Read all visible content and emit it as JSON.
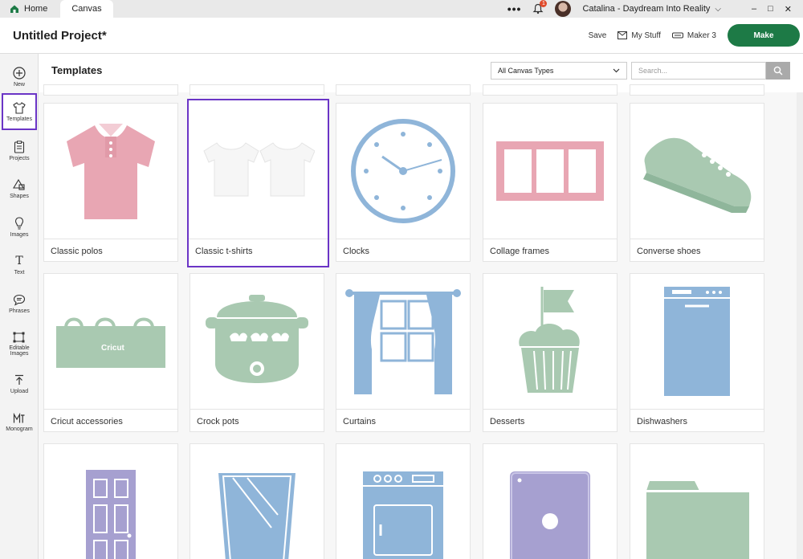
{
  "titlebar": {
    "home_tab": "Home",
    "canvas_tab": "Canvas",
    "notification_count": "1",
    "user_name": "Catalina - Daydream Into Reality"
  },
  "header": {
    "project_title": "Untitled Project*",
    "save_label": "Save",
    "my_stuff_label": "My Stuff",
    "machine_label": "Maker 3",
    "make_label": "Make"
  },
  "sidebar": {
    "items": [
      {
        "label": "New"
      },
      {
        "label": "Templates"
      },
      {
        "label": "Projects"
      },
      {
        "label": "Shapes"
      },
      {
        "label": "Images"
      },
      {
        "label": "Text"
      },
      {
        "label": "Phrases"
      },
      {
        "label": "Editable Images"
      },
      {
        "label": "Upload"
      },
      {
        "label": "Monogram"
      }
    ]
  },
  "templates": {
    "title": "Templates",
    "canvas_type": "All Canvas Types",
    "search_placeholder": "Search...",
    "cards": [
      {
        "label": "Classic polos"
      },
      {
        "label": "Classic t-shirts"
      },
      {
        "label": "Clocks"
      },
      {
        "label": "Collage frames"
      },
      {
        "label": "Converse shoes"
      },
      {
        "label": "Cricut accessories"
      },
      {
        "label": "Crock pots"
      },
      {
        "label": "Curtains"
      },
      {
        "label": "Desserts"
      },
      {
        "label": "Dishwashers"
      }
    ],
    "cricut_text": "Cricut"
  },
  "colors": {
    "accent": "#6b35c6",
    "brand_green": "#1d7a46",
    "pink": "#e8a6b3",
    "sage": "#a9c9b1",
    "blue": "#8fb5d9",
    "lavender": "#a6a0d0"
  }
}
